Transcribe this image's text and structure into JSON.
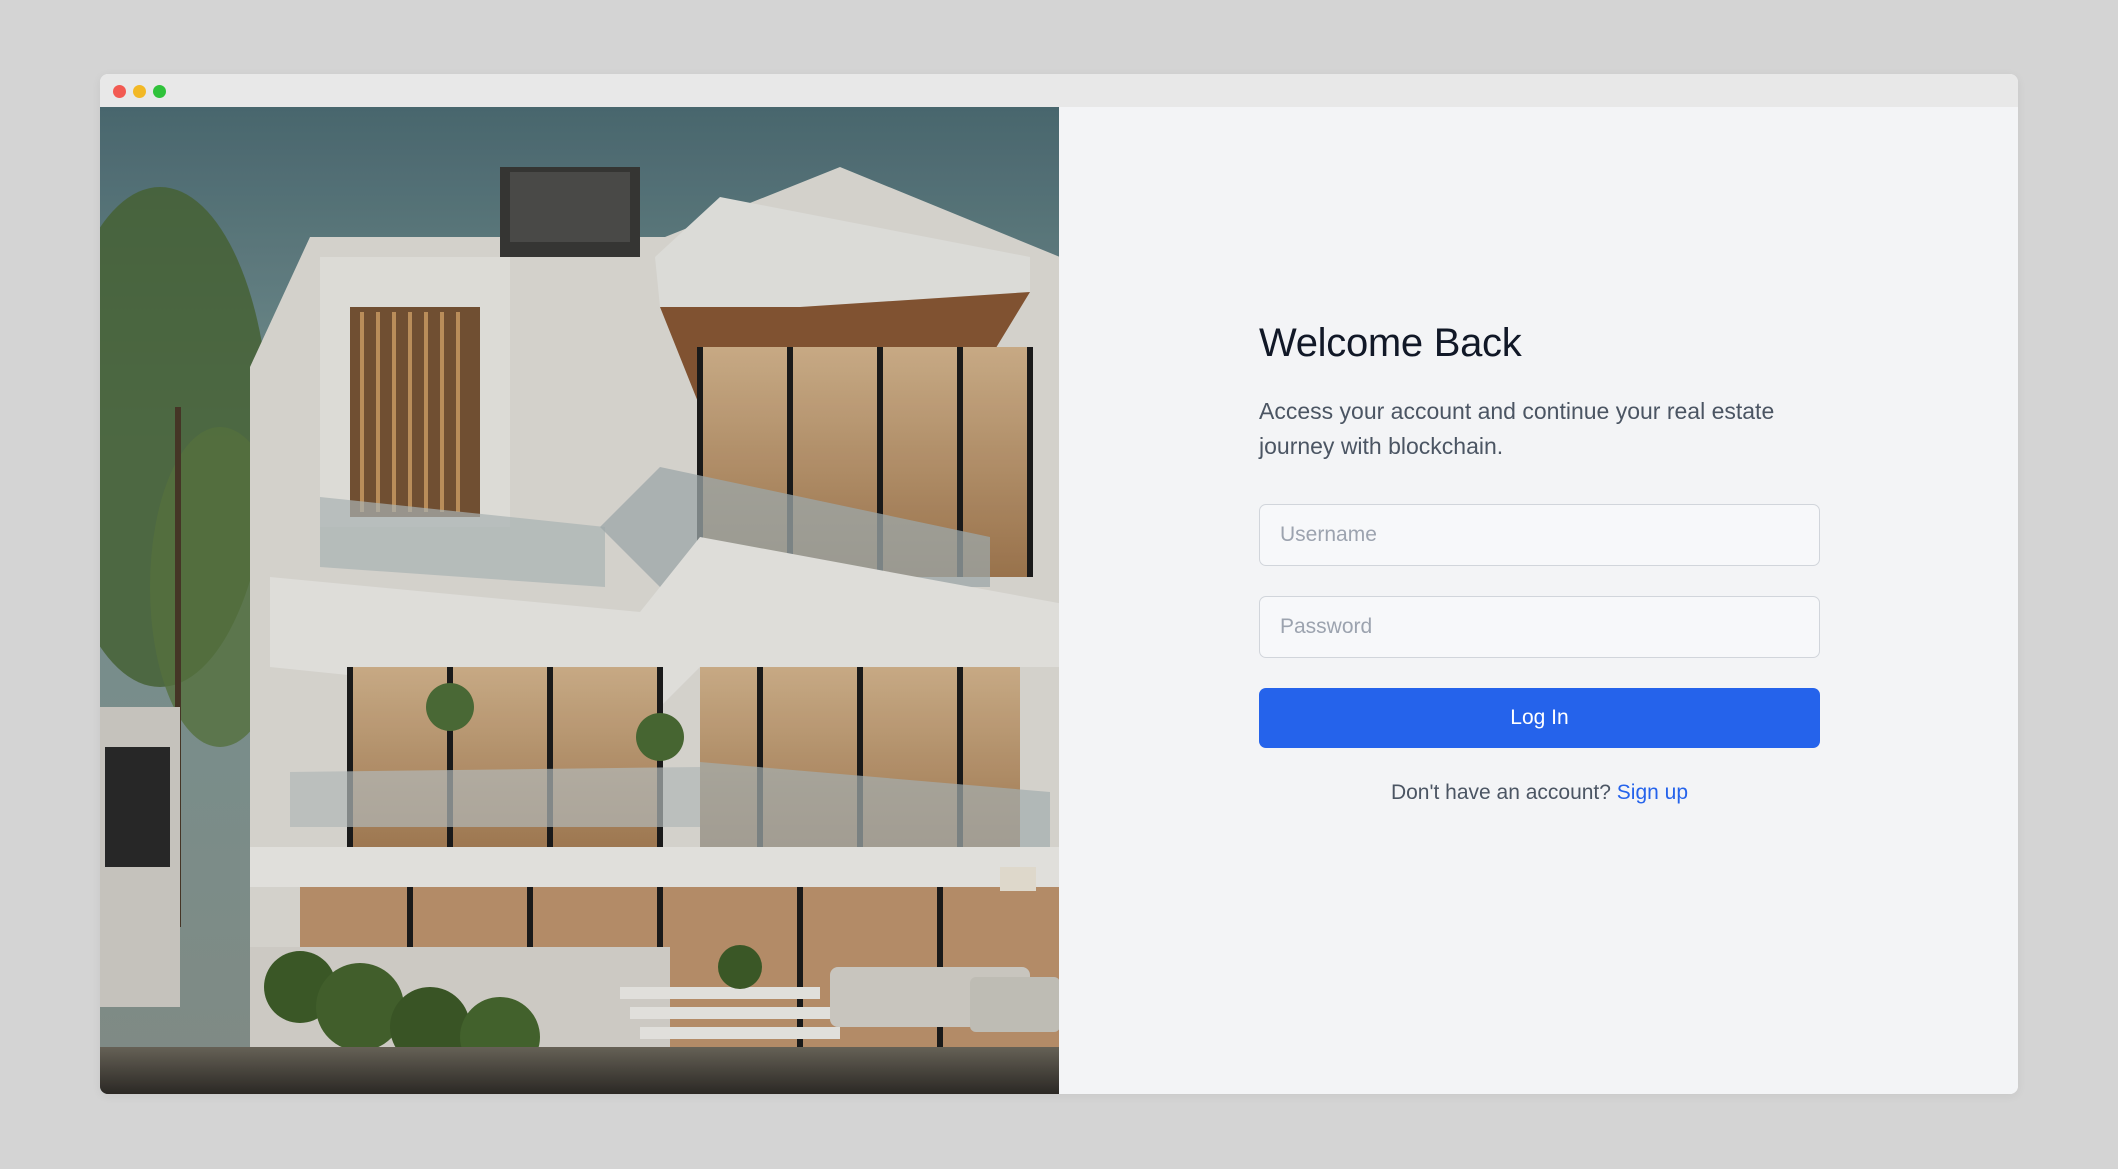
{
  "window": {
    "controls": {
      "close_color": "#f25a52",
      "minimize_color": "#f2b825",
      "maximize_color": "#2fc23a"
    }
  },
  "hero": {
    "icon": "modern-villa-photo"
  },
  "login": {
    "title": "Welcome Back",
    "subtitle": "Access your account and continue your real estate journey with blockchain.",
    "username_placeholder": "Username",
    "username_value": "",
    "password_placeholder": "Password",
    "password_value": "",
    "login_label": "Log In",
    "signup_prompt": "Don't have an account?",
    "signup_link": "Sign up"
  },
  "colors": {
    "accent": "#2563eb",
    "background": "#f3f4f6",
    "text_primary": "#111827",
    "text_secondary": "#4b5563"
  }
}
